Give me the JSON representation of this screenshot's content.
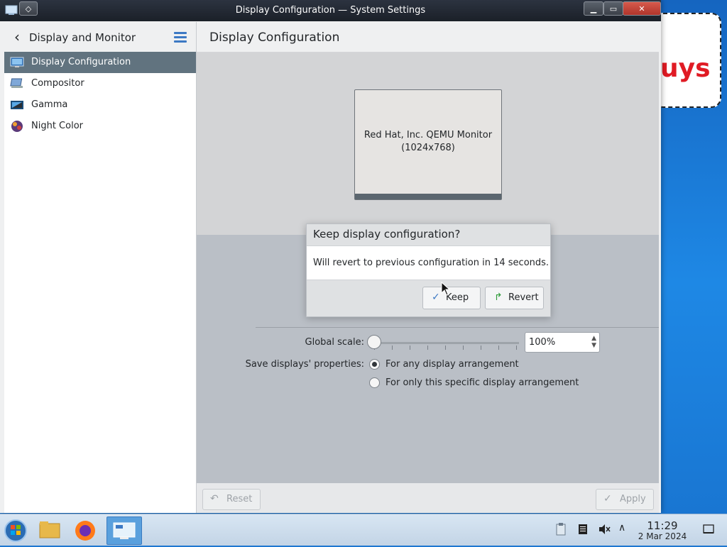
{
  "window": {
    "title": "Display Configuration — System Settings"
  },
  "sidebar": {
    "back_label": "Display and Monitor",
    "items": [
      {
        "label": "Display Configuration",
        "icon": "display-config-icon",
        "active": true
      },
      {
        "label": "Compositor",
        "icon": "compositor-icon",
        "active": false
      },
      {
        "label": "Gamma",
        "icon": "gamma-icon",
        "active": false
      },
      {
        "label": "Night Color",
        "icon": "night-color-icon",
        "active": false
      }
    ]
  },
  "main": {
    "title": "Display Configuration",
    "monitor": {
      "name": "Red Hat, Inc. QEMU Monitor",
      "resolution": "(1024x768)"
    },
    "global_scale": {
      "label": "Global scale:",
      "value": "100%"
    },
    "save_properties": {
      "label": "Save displays' properties:",
      "options": [
        {
          "label": "For any display arrangement",
          "checked": true
        },
        {
          "label": "For only this specific display arrangement",
          "checked": false
        }
      ]
    },
    "reset_label": "Reset",
    "apply_label": "Apply"
  },
  "dialog": {
    "title": "Keep display configuration?",
    "message": "Will revert to previous configuration in 14 seconds.",
    "keep_label": "Keep",
    "revert_label": "Revert"
  },
  "desktop": {
    "bubble_text": "uys"
  },
  "taskbar": {
    "time": "11:29",
    "date": "2 Mar 2024"
  },
  "colors": {
    "sidebar_active": "#61737f",
    "accent": "#3c79c4",
    "desktop": "#1e88e5"
  }
}
